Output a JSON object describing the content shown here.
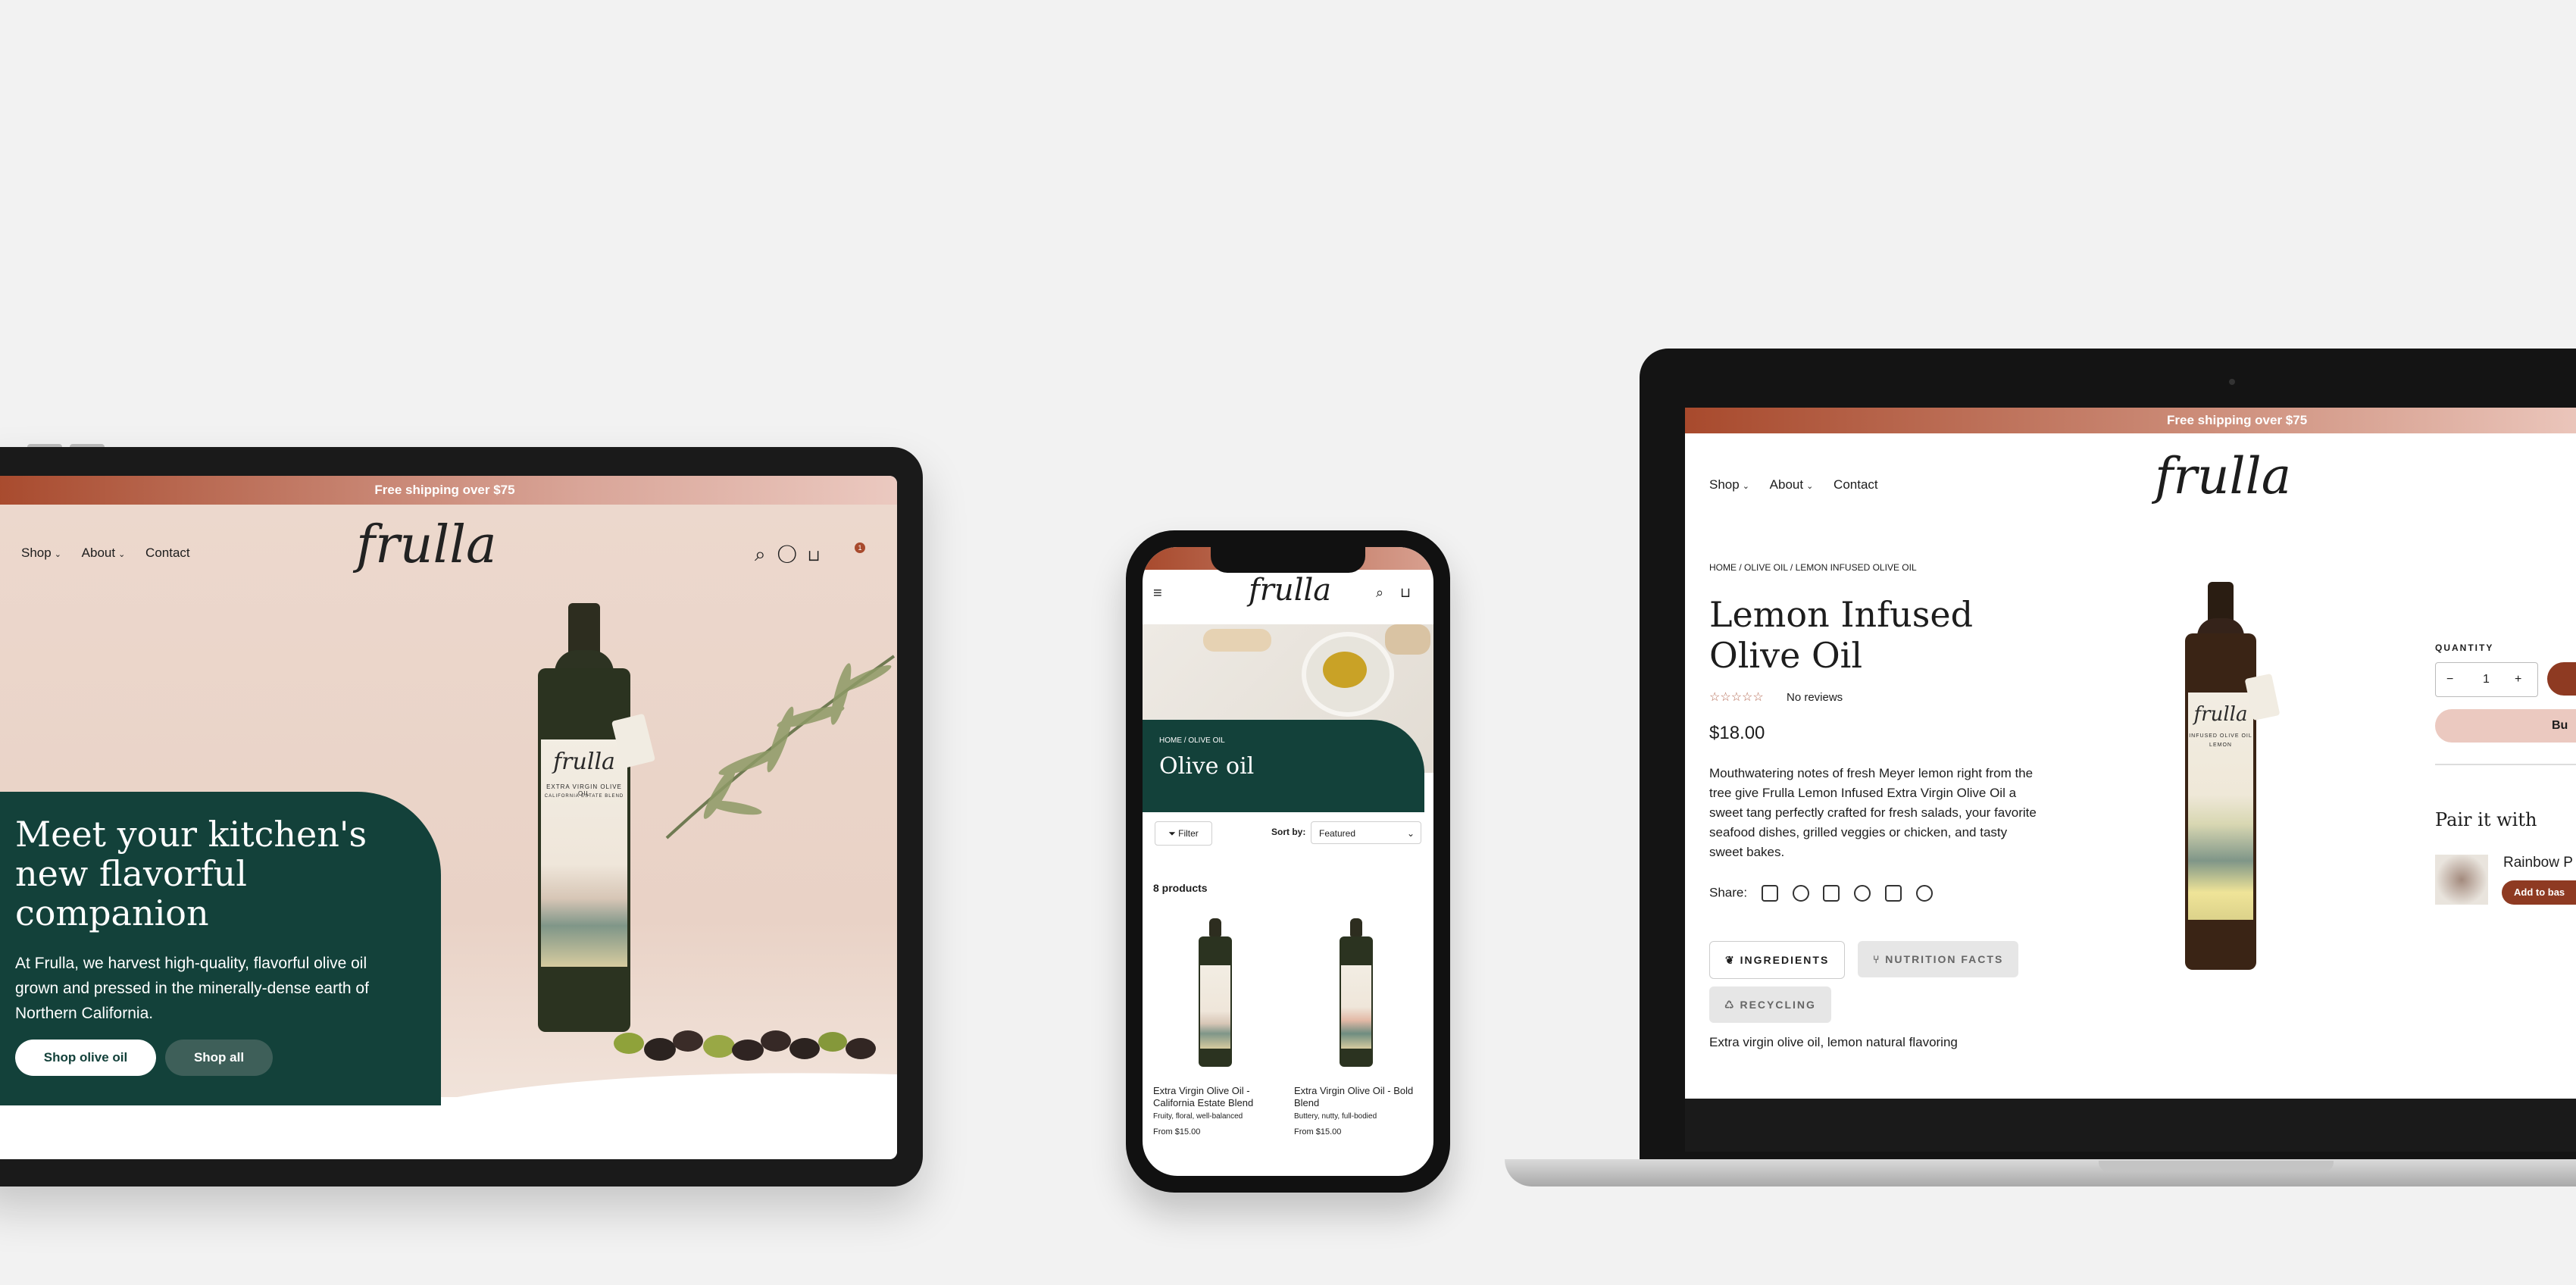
{
  "tablet": {
    "banner": "Free shipping over $75",
    "nav": [
      "Shop",
      "About",
      "Contact"
    ],
    "logo": "frulla",
    "cart_count": "1",
    "hero_title": "Meet your kitchen's new flavorful companion",
    "hero_text": "At Frulla, we harvest high-quality, flavorful olive oil grown and pressed in the minerally-dense earth of Northern California.",
    "btn_primary": "Shop olive oil",
    "btn_secondary": "Shop all",
    "bottle_label": "EXTRA VIRGIN OLIVE OIL",
    "bottle_sublabel": "CALIFORNIA ESTATE BLEND"
  },
  "phone": {
    "logo": "frulla",
    "breadcrumb": "HOME / OLIVE OIL",
    "title": "Olive oil",
    "filter": "Filter",
    "sort_label": "Sort by:",
    "sort_value": "Featured",
    "count": "8 products",
    "products": [
      {
        "name": "Extra Virgin Olive Oil - California Estate Blend",
        "desc": "Fruity, floral, well-balanced",
        "price": "From $15.00"
      },
      {
        "name": "Extra Virgin Olive Oil - Bold Blend",
        "desc": "Buttery, nutty, full-bodied",
        "price": "From $15.00"
      }
    ]
  },
  "laptop": {
    "banner": "Free shipping over $75",
    "nav": [
      "Shop",
      "About",
      "Contact"
    ],
    "logo": "frulla",
    "breadcrumb": "HOME / OLIVE OIL / LEMON INFUSED OLIVE OIL",
    "title": "Lemon Infused Olive Oil",
    "reviews": "No reviews",
    "price": "$18.00",
    "description": "Mouthwatering notes of fresh Meyer lemon right from the tree give Frulla Lemon Infused Extra Virgin Olive Oil a sweet tang perfectly crafted for fresh salads, your favorite seafood dishes, grilled veggies or chicken, and tasty sweet bakes.",
    "share": "Share:",
    "tabs": [
      "INGREDIENTS",
      "NUTRITION FACTS",
      "RECYCLING"
    ],
    "ingredients": "Extra virgin olive oil, lemon natural flavoring",
    "quantity_label": "QUANTITY",
    "quantity": "1",
    "buy_label": "Bu",
    "pair_title": "Pair it with",
    "pair_name": "Rainbow P",
    "pair_btn": "Add to bas",
    "bottle_label": "INFUSED OLIVE OIL",
    "bottle_sublabel": "LEMON"
  },
  "colors": {
    "accent": "#a84a2d",
    "green": "#13413a",
    "blush": "#ecd8cd"
  }
}
